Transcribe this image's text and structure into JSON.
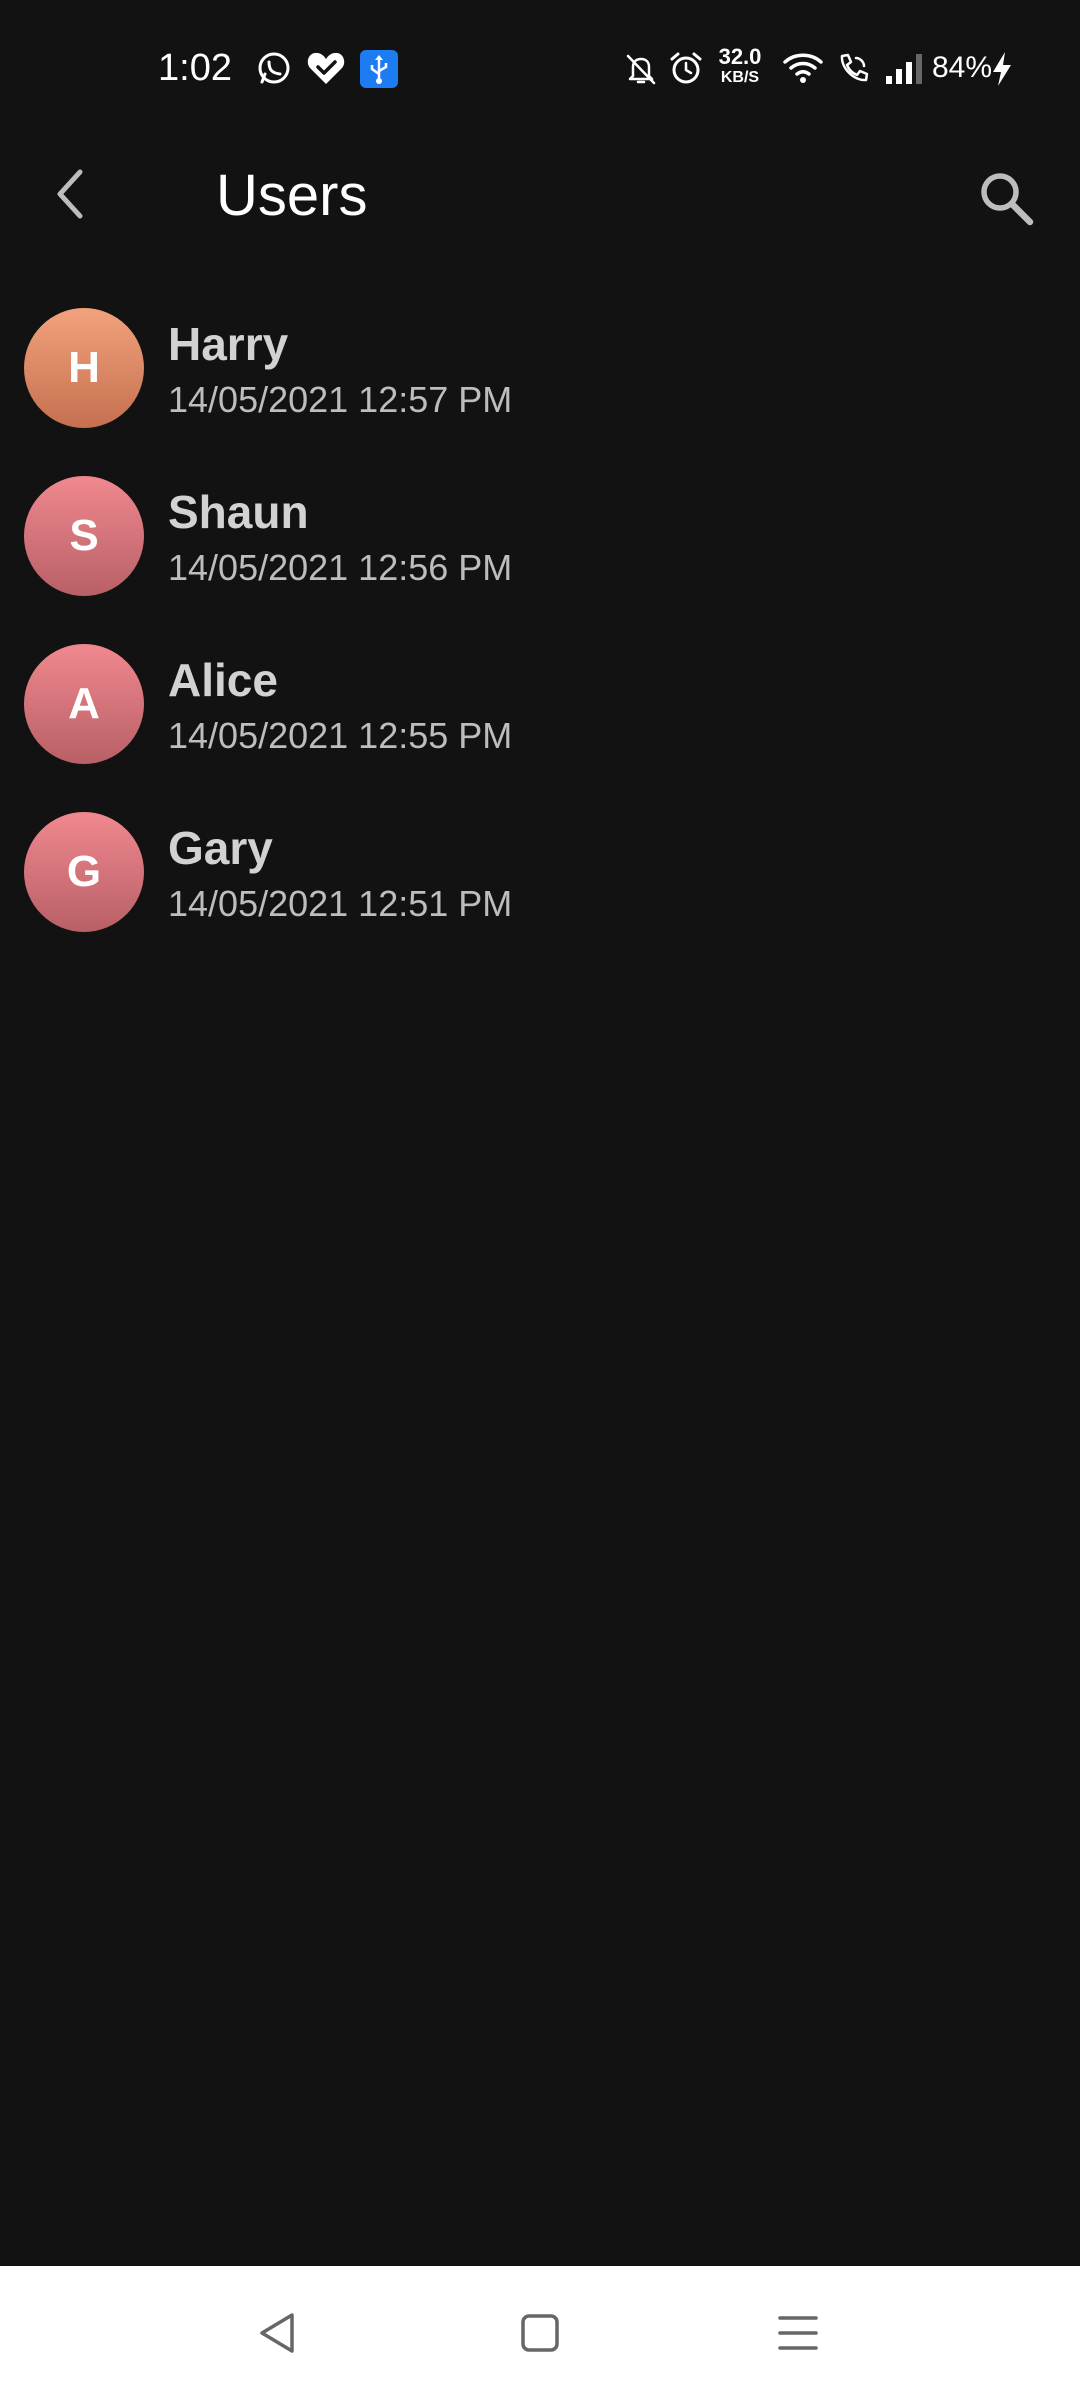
{
  "status_bar": {
    "time": "1:02",
    "net_speed_value": "32.0",
    "net_speed_unit": "KB/S",
    "battery_percent": "84%",
    "icons": [
      "whatsapp-icon",
      "heart-check-icon",
      "usb-icon",
      "notifications-off-icon",
      "alarm-icon",
      "wifi-icon",
      "wifi-calling-icon",
      "signal-icon",
      "charging-icon"
    ]
  },
  "header": {
    "title": "Users",
    "back_icon": "chevron-left-icon",
    "search_icon": "search-icon"
  },
  "users": [
    {
      "initial": "H",
      "name": "Harry",
      "timestamp": "14/05/2021 12:57 PM",
      "color_top": "#F2A27C",
      "color_bottom": "#C57050"
    },
    {
      "initial": "S",
      "name": "Shaun",
      "timestamp": "14/05/2021 12:56 PM",
      "color_top": "#F0888F",
      "color_bottom": "#B86066"
    },
    {
      "initial": "A",
      "name": "Alice",
      "timestamp": "14/05/2021 12:55 PM",
      "color_top": "#F0888F",
      "color_bottom": "#B86066"
    },
    {
      "initial": "G",
      "name": "Gary",
      "timestamp": "14/05/2021 12:51 PM",
      "color_top": "#F0888F",
      "color_bottom": "#B86066"
    }
  ],
  "nav_bar": {
    "icons": [
      "nav-back-icon",
      "nav-home-icon",
      "nav-menu-icon"
    ]
  },
  "colors": {
    "background": "#121212",
    "name_text": "#D2D2D2",
    "time_text": "#BDBDBD",
    "usb_badge": "#1E7CF2"
  }
}
